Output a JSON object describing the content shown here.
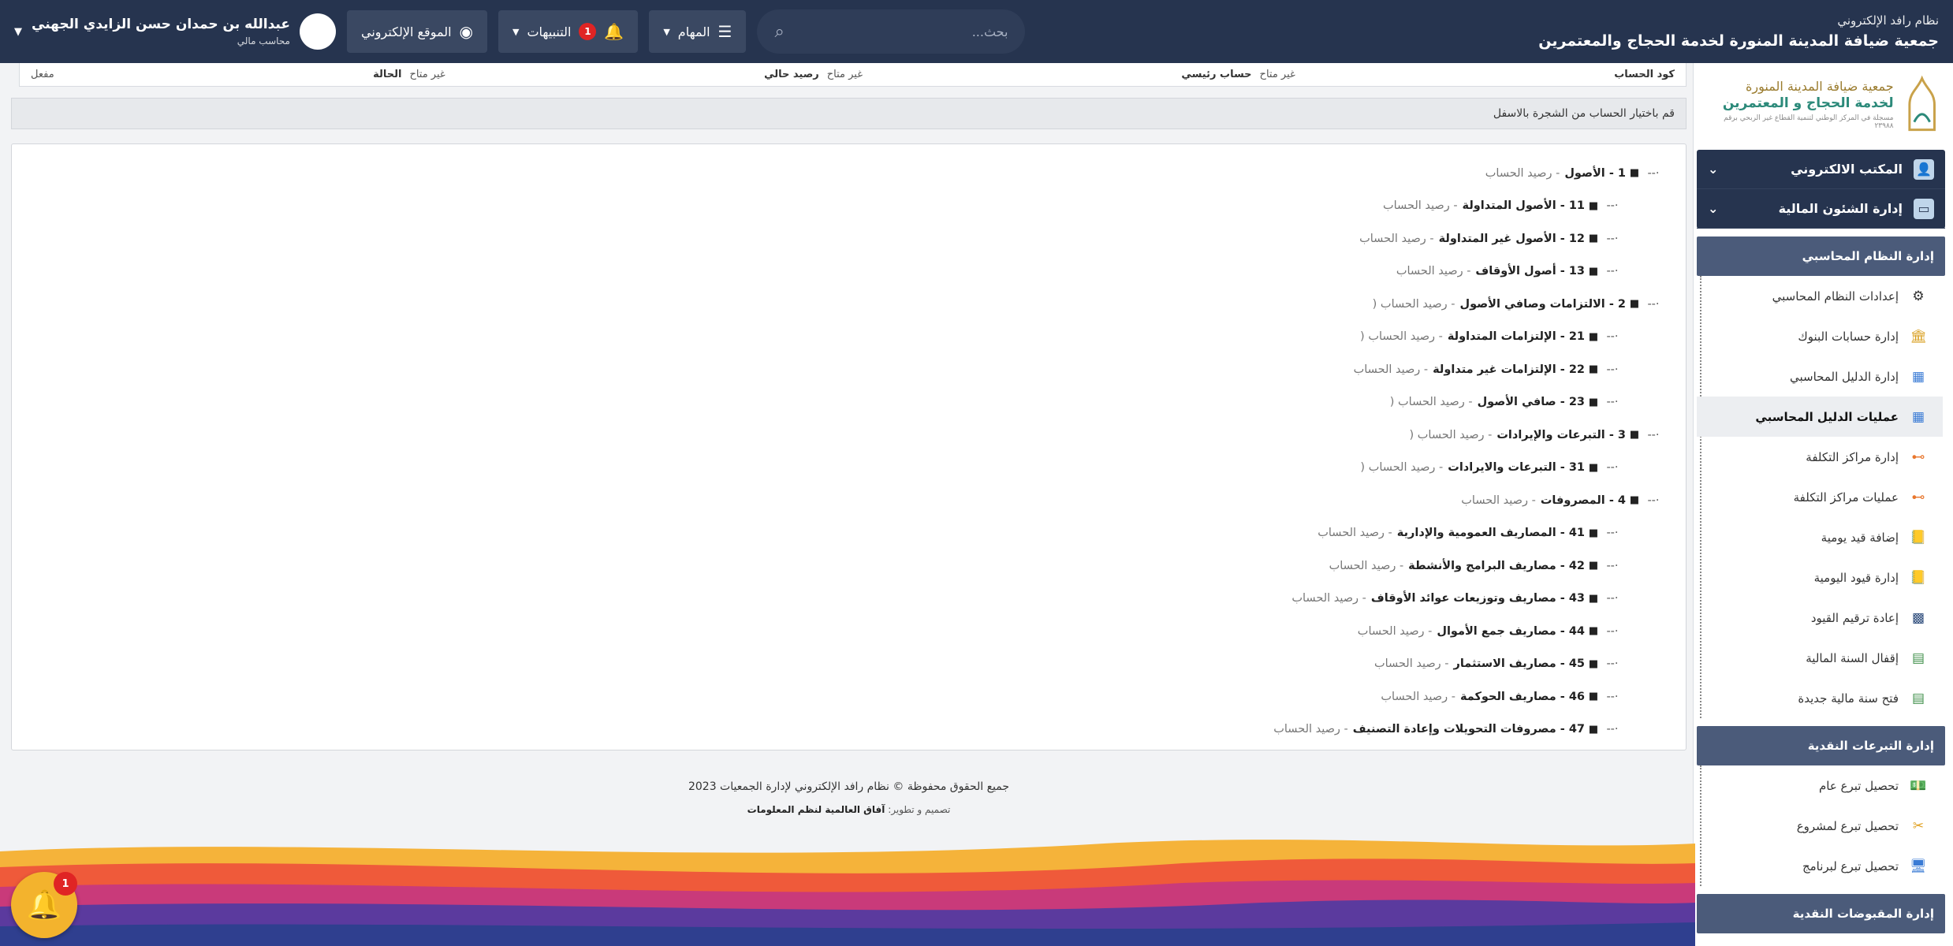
{
  "header": {
    "system_name": "نظام رافد الإلكتروني",
    "org_name": "جمعية ضيافة المدينة المنورة لخدمة الحجاج والمعتمرين",
    "search_placeholder": "بحث...",
    "tasks_label": "المهام",
    "alerts_label": "التنبيهات",
    "alerts_count": "1",
    "website_label": "الموقع الإلكتروني",
    "user_name": "عبدالله بن حمدان حسن الزايدي الجهني",
    "user_role": "محاسب مالي"
  },
  "sidebar": {
    "logo": {
      "line1": "جمعية ضيافة المدينة المنورة",
      "line2": "لخدمة الحجاج و المعتمرين",
      "line3": "مسجلة في المركز الوطني لتنمية القطاع غير الربحي برقم ٢٣٩٨٨"
    },
    "top_nav": [
      {
        "label": "المكتب الالكتروني",
        "icon": "user-icon"
      },
      {
        "label": "إدارة الشئون المالية",
        "icon": "money-icon"
      }
    ],
    "sections": [
      {
        "title": "إدارة النظام المحاسبي",
        "items": [
          {
            "label": "إعدادات النظام المحاسبي",
            "icon": "settings-icon"
          },
          {
            "label": "إدارة حسابات البنوك",
            "icon": "bank-icon"
          },
          {
            "label": "إدارة الدليل المحاسبي",
            "icon": "tree-icon"
          },
          {
            "label": "عمليات الدليل المحاسبي",
            "icon": "tree-gear-icon",
            "active": true
          },
          {
            "label": "إدارة مراكز التكلفة",
            "icon": "cost-centers-icon"
          },
          {
            "label": "عمليات مراكز التكلفة",
            "icon": "cost-centers-gear-icon"
          },
          {
            "label": "إضافة قيد يومية",
            "icon": "journal-add-icon"
          },
          {
            "label": "إدارة قيود اليومية",
            "icon": "journal-icon"
          },
          {
            "label": "إعادة ترقيم القيود",
            "icon": "renumber-icon"
          },
          {
            "label": "إقفال السنة المالية",
            "icon": "close-year-icon"
          },
          {
            "label": "فتح سنة مالية جديدة",
            "icon": "open-year-icon"
          }
        ]
      },
      {
        "title": "إدارة التبرعات النقدية",
        "items": [
          {
            "label": "تحصيل تبرع عام",
            "icon": "donation-icon"
          },
          {
            "label": "تحصيل تبرع لمشروع",
            "icon": "tools-icon"
          },
          {
            "label": "تحصيل تبرع لبرنامج",
            "icon": "monitor-icon"
          }
        ]
      },
      {
        "title": "إدارة المقبوضات النقدية",
        "items": []
      }
    ]
  },
  "account_bar": {
    "code_label": "كود الحساب",
    "code_value": "غير متاح",
    "main_account_label": "حساب رئيسي",
    "balance_label": "رصيد حالي",
    "balance_value": "غير متاح",
    "status_label": "الحالة",
    "status_value": "غير متاح",
    "enabled_label": "مفعل"
  },
  "hint_text": "قم باختيار الحساب من الشجرة بالاسفل",
  "tree": [
    {
      "text": "1 - الأصول",
      "balance": " - رصيد الحساب ",
      "level": 1
    },
    {
      "text": "11 - الأصول المتداولة",
      "balance": " - رصيد الحساب ",
      "level": 2
    },
    {
      "text": "12 - الأصول غير المتداولة",
      "balance": " - رصيد الحساب ",
      "level": 2
    },
    {
      "text": "13 - أصول الأوقاف",
      "balance": " - رصيد الحساب ",
      "level": 2
    },
    {
      "text": "2 - الالتزامات وصافي الأصول",
      "balance": " - رصيد الحساب ( ",
      "level": 1
    },
    {
      "text": "21 - الإلتزامات المتداولة",
      "balance": " - رصيد الحساب ( ",
      "level": 2
    },
    {
      "text": "22 - الإلتزامات غير متداولة",
      "balance": " - رصيد الحساب ",
      "level": 2
    },
    {
      "text": "23 - صافي الأصول",
      "balance": " - رصيد الحساب ( ",
      "level": 2
    },
    {
      "text": "3 - التبرعات والإيرادات",
      "balance": " - رصيد الحساب ( ",
      "level": 1
    },
    {
      "text": "31 - التبرعات والايرادات",
      "balance": " - رصيد الحساب ( ",
      "level": 2
    },
    {
      "text": "4 - المصروفات",
      "balance": " - رصيد الحساب ",
      "level": 1
    },
    {
      "text": "41 - المصاريف العمومية والإدارية",
      "balance": " - رصيد الحساب ",
      "level": 2
    },
    {
      "text": "42 - مصاريف البرامج والأنشطة",
      "balance": " - رصيد الحساب ",
      "level": 2
    },
    {
      "text": "43 - مصاريف وتوزيعات عوائد الأوقاف",
      "balance": " - رصيد الحساب ",
      "level": 2
    },
    {
      "text": "44 - مصاريف جمع الأموال",
      "balance": " - رصيد الحساب ",
      "level": 2
    },
    {
      "text": "45 - مصاريف الاستثمار",
      "balance": " - رصيد الحساب ",
      "level": 2
    },
    {
      "text": "46 - مصاريف الحوكمة",
      "balance": " - رصيد الحساب ",
      "level": 2
    },
    {
      "text": "47 - مصروفات التحويلات وإعادة التصنيف",
      "balance": " - رصيد الحساب ",
      "level": 2
    }
  ],
  "footer": {
    "copyright": "جميع الحقوق محفوظة © نظام رافد الإلكتروني لإدارة الجمعيات 2023",
    "dev_prefix": "تصميم و تطوير:",
    "dev_name": "آفاق العالمية لنظم المعلومات"
  },
  "fab": {
    "badge": "1"
  },
  "colors": {
    "header": "#26344f",
    "section": "#4b5b7a",
    "accent": "#f3b32d",
    "alert": "#e02424"
  }
}
